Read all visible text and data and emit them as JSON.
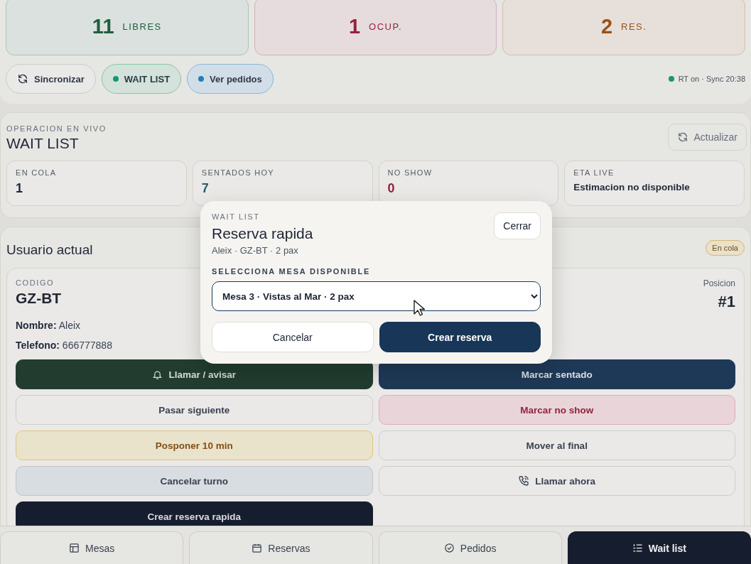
{
  "stats": [
    {
      "value": "11",
      "label": "LIBRES",
      "color": "#17603f"
    },
    {
      "value": "1",
      "label": "OCUP.",
      "color": "#9b1c3c"
    },
    {
      "value": "2",
      "label": "RES.",
      "color": "#a0520f"
    }
  ],
  "chips": [
    {
      "kind": "sync",
      "label": "Sincronizar"
    },
    {
      "kind": "dot",
      "label": "WAIT LIST",
      "color": "#12a06a"
    },
    {
      "kind": "dot",
      "label": "Ver pedidos",
      "color": "#1a86c8"
    }
  ],
  "status": {
    "text": "RT on · Sync 20:38",
    "color": "#12a06a"
  },
  "live": {
    "eyebrow": "OPERACION EN VIVO",
    "title": "WAIT LIST",
    "refresh": "Actualizar",
    "metrics": [
      {
        "label": "EN COLA",
        "value": "1",
        "color": "#1b2333"
      },
      {
        "label": "SENTADOS HOY",
        "value": "7",
        "color": "#1f5f6b"
      },
      {
        "label": "NO SHOW",
        "value": "0",
        "color": "#9b1c3c"
      },
      {
        "label": "ETA LIVE",
        "value": "Estimacion no disponible",
        "color": "#1b2333"
      }
    ]
  },
  "current": {
    "title": "Usuario actual",
    "badge": "En cola",
    "code_label": "CODIGO",
    "code": "GZ-BT",
    "name_label": "Nombre:",
    "name": "Aleix",
    "phone_label": "Telefono:",
    "phone": "666777888",
    "position_label": "Posicion",
    "position": "#1",
    "actions": [
      {
        "kind": "notify",
        "label": "Llamar / avisar"
      },
      {
        "kind": "seat",
        "label": "Marcar sentado"
      },
      {
        "kind": "skip",
        "label": "Pasar siguiente"
      },
      {
        "kind": "no_show",
        "label": "Marcar no show"
      },
      {
        "kind": "postpone",
        "label": "Posponer 10 min"
      },
      {
        "kind": "move_last",
        "label": "Mover al final"
      },
      {
        "kind": "cancel",
        "label": "Cancelar turno"
      },
      {
        "kind": "call",
        "label": "Llamar ahora"
      },
      {
        "kind": "quick_reserve",
        "label": "Crear reserva rapida"
      }
    ]
  },
  "nav": [
    {
      "label": "Mesas",
      "selected": false
    },
    {
      "label": "Reservas",
      "selected": false
    },
    {
      "label": "Pedidos",
      "selected": false
    },
    {
      "label": "Wait list",
      "selected": true
    }
  ],
  "modal": {
    "eyebrow": "WAIT LIST",
    "title": "Reserva rapida",
    "subtitle": "Aleix · GZ-BT · 2 pax",
    "close": "Cerrar",
    "select_label": "SELECCIONA MESA DISPONIBLE",
    "select_value": "Mesa 3 · Vistas al Mar · 2 pax",
    "cancel": "Cancelar",
    "confirm": "Crear reserva"
  }
}
